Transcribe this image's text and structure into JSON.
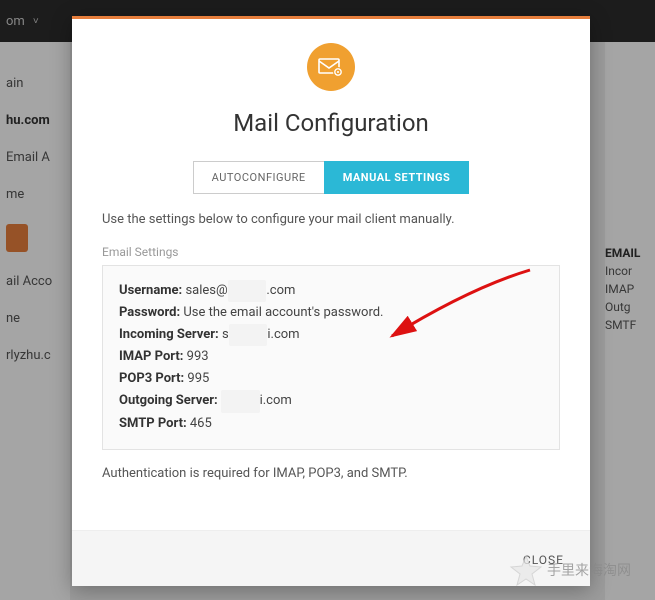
{
  "topbar": {
    "domain_frag": "om",
    "chevron": "˅"
  },
  "bg_left": {
    "l1": "ain",
    "l2": "hu.com",
    "l3": "Email A",
    "l4": "me",
    "l5": "ail Acco",
    "l6": "ne",
    "l7": "rlyzhu.c"
  },
  "bg_right": {
    "h": "EMAIL",
    "r1": "Incor",
    "r2": "IMAP",
    "r3": "Outg",
    "r4": "SMTF"
  },
  "modal": {
    "title": "Mail Configuration",
    "tabs": {
      "auto": "AUTOCONFIGURE",
      "manual": "MANUAL SETTINGS"
    },
    "desc": "Use the settings below to configure your mail client manually.",
    "section_label": "Email Settings",
    "settings": {
      "username_label": "Username:",
      "username_value_pre": "sales@",
      "username_value_suf": ".com",
      "password_label": "Password:",
      "password_value": "Use the email account's password.",
      "incoming_label": "Incoming Server:",
      "incoming_value_pre": "s",
      "incoming_value_suf": "i.com",
      "imap_label": "IMAP Port:",
      "imap_value": "993",
      "pop3_label": "POP3 Port:",
      "pop3_value": "995",
      "outgoing_label": "Outgoing Server:",
      "outgoing_value_suf": "i.com",
      "smtp_label": "SMTP Port:",
      "smtp_value": "465"
    },
    "auth_note": "Authentication is required for IMAP, POP3, and SMTP.",
    "close": "CLOSE"
  },
  "watermark": "手里来海淘网"
}
